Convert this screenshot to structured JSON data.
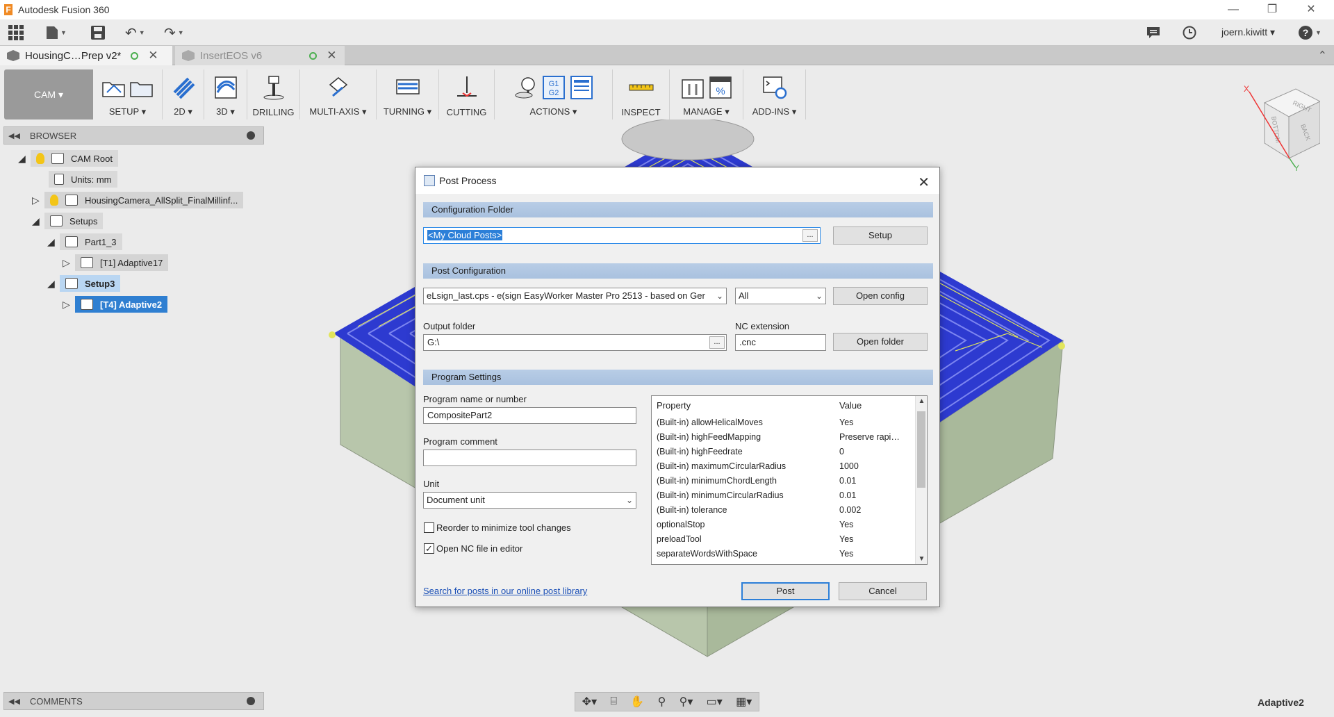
{
  "app": {
    "title": "Autodesk Fusion 360",
    "icon": "fusion-f-icon"
  },
  "window_controls": {
    "minimize": "—",
    "restore": "❐",
    "close": "✕"
  },
  "quick_access": {
    "user": "joern.kiwitt ▾"
  },
  "doc_tabs": [
    {
      "label": "HousingC…Prep v2*",
      "active": true
    },
    {
      "label": "InsertEOS v6",
      "active": false
    }
  ],
  "ribbon": {
    "workspace": "CAM ▾",
    "groups": [
      {
        "id": "setup",
        "label": "SETUP ▾"
      },
      {
        "id": "2d",
        "label": "2D ▾"
      },
      {
        "id": "3d",
        "label": "3D ▾"
      },
      {
        "id": "drilling",
        "label": "DRILLING"
      },
      {
        "id": "multiaxis",
        "label": "MULTI-AXIS ▾"
      },
      {
        "id": "turning",
        "label": "TURNING ▾"
      },
      {
        "id": "cutting",
        "label": "CUTTING"
      },
      {
        "id": "actions",
        "label": "ACTIONS ▾"
      },
      {
        "id": "inspect",
        "label": "INSPECT"
      },
      {
        "id": "manage",
        "label": "MANAGE ▾"
      },
      {
        "id": "addins",
        "label": "ADD-INS ▾"
      }
    ]
  },
  "browser": {
    "title": "BROWSER",
    "nodes": {
      "cam_root": "CAM Root",
      "units": "Units: mm",
      "model": "HousingCamera_AllSplit_FinalMillinf...",
      "setups": "Setups",
      "part1": "Part1_3",
      "op1": "[T1] Adaptive17",
      "setup3": "Setup3",
      "op2": "[T4] Adaptive2"
    }
  },
  "comments": {
    "title": "COMMENTS"
  },
  "status": {
    "active_operation": "Adaptive2"
  },
  "view_cube": {
    "faces": [
      "RIGHT",
      "BOTTOM",
      "BACK"
    ],
    "axes": [
      "X",
      "Y"
    ]
  },
  "dialog": {
    "title": "Post Process",
    "config_folder": {
      "heading": "Configuration Folder",
      "value": "<My Cloud Posts>",
      "browse": "...",
      "setup_button": "Setup"
    },
    "post_config": {
      "heading": "Post Configuration",
      "post": "eLsign_last.cps - e(sign EasyWorker Master Pro 2513 - based on Ger",
      "filter": "All",
      "open_config": "Open config",
      "output_folder_label": "Output folder",
      "output_folder": "G:\\",
      "browse": "...",
      "nc_extension_label": "NC extension",
      "nc_extension": ".cnc",
      "open_folder": "Open folder"
    },
    "program_settings": {
      "heading": "Program Settings",
      "name_label": "Program name or number",
      "name_value": "CompositePart2",
      "comment_label": "Program comment",
      "comment_value": "",
      "unit_label": "Unit",
      "unit_value": "Document unit",
      "reorder_label": "Reorder to minimize tool changes",
      "reorder_checked": false,
      "open_nc_label": "Open NC file in editor",
      "open_nc_checked": true,
      "property_header": "Property",
      "value_header": "Value",
      "properties": [
        {
          "key": "(Built-in) allowHelicalMoves",
          "value": "Yes"
        },
        {
          "key": "(Built-in) highFeedMapping",
          "value": "Preserve rapi…"
        },
        {
          "key": "(Built-in) highFeedrate",
          "value": "0"
        },
        {
          "key": "(Built-in) maximumCircularRadius",
          "value": "1000"
        },
        {
          "key": "(Built-in) minimumChordLength",
          "value": "0.01"
        },
        {
          "key": "(Built-in) minimumCircularRadius",
          "value": "0.01"
        },
        {
          "key": "(Built-in) tolerance",
          "value": "0.002"
        },
        {
          "key": "optionalStop",
          "value": "Yes"
        },
        {
          "key": "preloadTool",
          "value": "Yes"
        },
        {
          "key": "separateWordsWithSpace",
          "value": "Yes"
        }
      ]
    },
    "library_link": "Search for posts in our online post library",
    "post_button": "Post",
    "cancel_button": "Cancel"
  }
}
